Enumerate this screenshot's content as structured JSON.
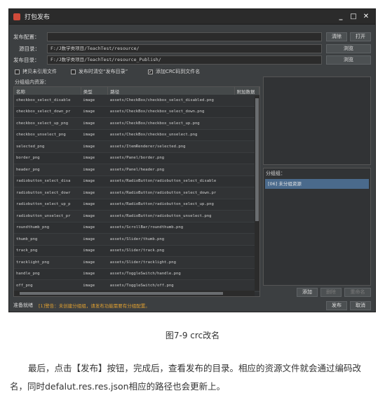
{
  "window": {
    "title": "打包发布",
    "controls": [
      "_",
      "□",
      "✕"
    ]
  },
  "publish_config": {
    "label": "发布配置：",
    "value": "",
    "clear_button": "清除",
    "open_button": "打开"
  },
  "source_dir": {
    "label": "源目录：",
    "value": "F:/J数学类项目/TeachTest/resource/",
    "browse_button": "浏览"
  },
  "publish_dir": {
    "label": "发布目录：",
    "value": "F:/J数学类项目/TeachTest/resource_Publish/",
    "browse_button": "浏览"
  },
  "options": [
    {
      "label": "拷贝未引用文件",
      "checked": false
    },
    {
      "label": "发布时清空“发布目录”",
      "checked": false
    },
    {
      "label": "添加CRC码到文件名",
      "checked": true
    }
  ],
  "resources_panel": {
    "title": "分组组内资源：",
    "columns": [
      "名称",
      "类型",
      "路径",
      "附加数据"
    ],
    "rows": [
      [
        "checkbox_select_disable",
        "image",
        "assets/CheckBox/checkbox_select_disabled.png",
        ""
      ],
      [
        "checkbox_select_down_pr",
        "image",
        "assets/CheckBox/checkbox_select_down.png",
        ""
      ],
      [
        "checkbox_select_up_png",
        "image",
        "assets/CheckBox/checkbox_select_up.png",
        ""
      ],
      [
        "checkbox_unselect_png",
        "image",
        "assets/CheckBox/checkbox_unselect.png",
        ""
      ],
      [
        "selected_png",
        "image",
        "assets/ItemRenderer/selected.png",
        ""
      ],
      [
        "border_png",
        "image",
        "assets/Panel/border.png",
        ""
      ],
      [
        "header_png",
        "image",
        "assets/Panel/header.png",
        ""
      ],
      [
        "radiobutton_select_disa",
        "image",
        "assets/RadioButton/radiobutton_select_disable",
        ""
      ],
      [
        "radiobutton_select_dowr",
        "image",
        "assets/RadioButton/radiobutton_select_down.pr",
        ""
      ],
      [
        "radiobutton_select_up_p",
        "image",
        "assets/RadioButton/radiobutton_select_up.png",
        ""
      ],
      [
        "radiobutton_unselect_pr",
        "image",
        "assets/RadioButton/radiobutton_unselect.png",
        ""
      ],
      [
        "roundthumb_png",
        "image",
        "assets/ScrollBar/roundthumb.png",
        ""
      ],
      [
        "thumb_png",
        "image",
        "assets/Slider/thumb.png",
        ""
      ],
      [
        "track_png",
        "image",
        "assets/Slider/track.png",
        ""
      ],
      [
        "tracklight_png",
        "image",
        "assets/Slider/tracklight.png",
        ""
      ],
      [
        "handle_png",
        "image",
        "assets/ToggleSwitch/handle.png",
        ""
      ],
      [
        "off_png",
        "image",
        "assets/ToggleSwitch/off.png",
        ""
      ],
      [
        "on_png",
        "image",
        "assets/ToggleSwitch/on.png",
        ""
      ]
    ]
  },
  "groups_panel": {
    "title": "分组组：",
    "items": [
      "[06] 未分组资源"
    ],
    "add_button": "添加",
    "delete_button": "删除",
    "rename_button": "重命名"
  },
  "status": {
    "ready": "准备就绪",
    "warning": "[1]警告：未创建分组组，请发布功能需要有分组配置。"
  },
  "footer_buttons": {
    "publish": "发布",
    "cancel": "取消"
  },
  "caption": "图7-9 crc改名",
  "paragraph": "最后，点击【发布】按钮，完成后，查看发布的目录。相应的资源文件就会通过编码改名，同时defalut.res.res.json相应的路径也会更新上。"
}
